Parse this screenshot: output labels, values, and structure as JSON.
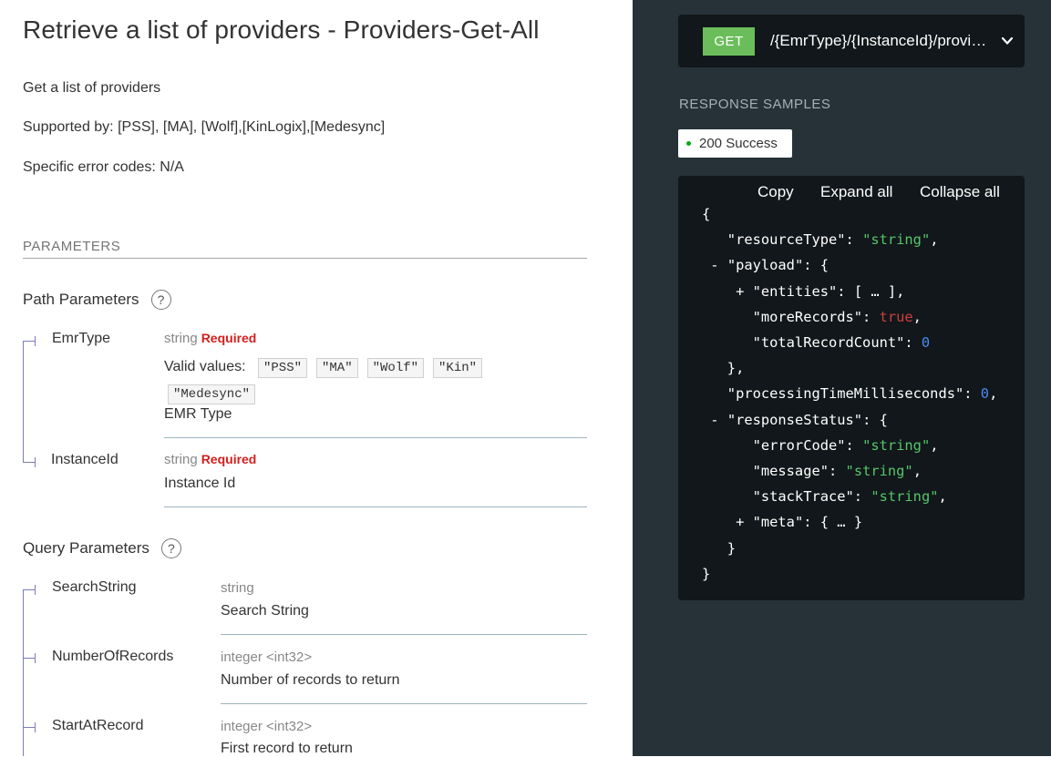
{
  "title": "Retrieve a list of providers - Providers-Get-All",
  "description": "Get a list of providers",
  "supported_by": "Supported by: [PSS], [MA], [Wolf],[KinLogix],[Medesync]",
  "error_codes": "Specific error codes: N/A",
  "parameters_heading": "PARAMETERS",
  "path_params": {
    "heading": "Path Parameters",
    "help": "?",
    "items": [
      {
        "name": "EmrType",
        "type": "string",
        "required": "Required",
        "valid_label": "Valid values:",
        "valid_values": [
          "\"PSS\"",
          "\"MA\"",
          "\"Wolf\"",
          "\"Kin\"",
          "\"Medesync\""
        ],
        "desc": "EMR Type"
      },
      {
        "name": "InstanceId",
        "type": "string",
        "required": "Required",
        "desc": "Instance Id"
      }
    ]
  },
  "query_params": {
    "heading": "Query Parameters",
    "help": "?",
    "items": [
      {
        "name": "SearchString",
        "type": "string",
        "desc": "Search String"
      },
      {
        "name": "NumberOfRecords",
        "type": "integer <int32>",
        "desc": "Number of records to return"
      },
      {
        "name": "StartAtRecord",
        "type": "integer <int32>",
        "desc": "First record to return"
      }
    ]
  },
  "endpoint": {
    "method": "GET",
    "path": "/{EmrType}/{InstanceId}/providers",
    "chevron": "chevron-down-icon"
  },
  "response": {
    "heading": "RESPONSE SAMPLES",
    "tab_label": "200 Success",
    "copy": "Copy",
    "expand_all": "Expand all",
    "collapse_all": "Collapse all"
  },
  "json_sample": {
    "resourceType": "string",
    "payload": {
      "entities": "[ … ]",
      "moreRecords": "true",
      "totalRecordCount": "0"
    },
    "processingTimeMilliseconds": "0",
    "responseStatus": {
      "errorCode": "string",
      "message": "string",
      "stackTrace": "string",
      "meta": "{ … }"
    }
  },
  "colors": {
    "get": "#6bbd5b",
    "required": "#d41f1c",
    "right_panel": "#263238",
    "code_bg": "#11171a",
    "string": "#57c56b",
    "bool": "#d03e3e",
    "number": "#4a8bee"
  }
}
